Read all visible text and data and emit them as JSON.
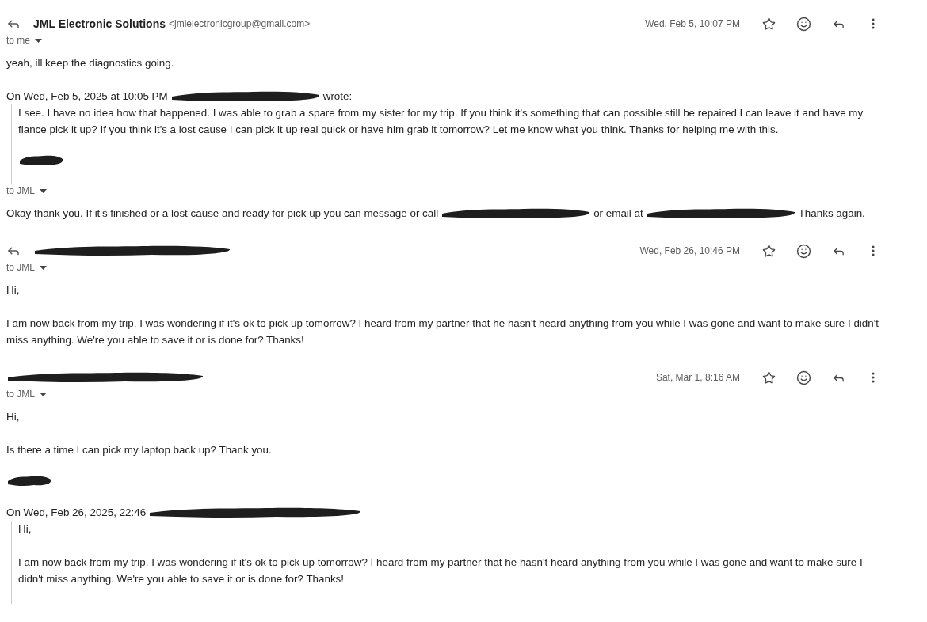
{
  "messages": [
    {
      "header": {
        "reply_icon": true,
        "sender": [
          {
            "kind": "name",
            "text": "JML Electronic Solutions"
          },
          {
            "kind": "email",
            "text": "<jmlelectronicgroup@gmail.com>"
          }
        ],
        "date": "Wed, Feb 5, 10:07 PM"
      },
      "recipients": "to me",
      "blocks": [
        {
          "kind": "paragraph",
          "segments": [
            {
              "kind": "text",
              "text": "yeah, ill keep the diagnostics going."
            }
          ]
        },
        {
          "kind": "attribution",
          "segments": [
            {
              "kind": "text",
              "text": "On Wed, Feb 5, 2025 at 10:05 PM"
            },
            {
              "kind": "redaction"
            },
            {
              "kind": "text",
              "text": "wrote:"
            }
          ]
        },
        {
          "kind": "quote",
          "children": [
            {
              "kind": "paragraph",
              "segments": [
                {
                  "kind": "text",
                  "text": "I see. I have no idea how that happened. I was able to grab a spare from my sister for my trip. If you think it's something that can possible still be repaired I can leave it and have my fiance pick it up? If you think it's a lost cause I can pick it up real quick or have him grab it tomorrow? Let me know what you think. Thanks for helping me with this."
                }
              ]
            },
            {
              "kind": "signature"
            }
          ]
        }
      ]
    },
    {
      "recipients": "to JML",
      "blocks": [
        {
          "kind": "paragraph",
          "segments": [
            {
              "kind": "text",
              "text": "Okay thank you. If it's finished or a lost cause and ready for pick up you can message or call"
            },
            {
              "kind": "redaction"
            },
            {
              "kind": "text",
              "text": "or email at"
            },
            {
              "kind": "redaction"
            },
            {
              "kind": "text",
              "text": "Thanks again."
            }
          ]
        }
      ]
    },
    {
      "header": {
        "reply_icon": true,
        "sender": [
          {
            "kind": "redaction"
          }
        ],
        "date": "Wed, Feb 26, 10:46 PM"
      },
      "recipients": "to JML",
      "blocks": [
        {
          "kind": "paragraph",
          "segments": [
            {
              "kind": "text",
              "text": "Hi,"
            }
          ]
        },
        {
          "kind": "paragraph",
          "segments": [
            {
              "kind": "text",
              "text": "I am now back from my trip. I was wondering if it's ok to pick up tomorrow? I heard from my partner that he hasn't heard anything from you while I was gone and want to make sure I didn't miss anything. We're you able to save it or is done for? Thanks!"
            }
          ]
        }
      ]
    },
    {
      "header": {
        "reply_icon": false,
        "sender": [
          {
            "kind": "redaction"
          }
        ],
        "date": "Sat, Mar 1, 8:16 AM"
      },
      "recipients": "to JML",
      "blocks": [
        {
          "kind": "paragraph",
          "segments": [
            {
              "kind": "text",
              "text": "Hi,"
            }
          ]
        },
        {
          "kind": "paragraph",
          "segments": [
            {
              "kind": "text",
              "text": "Is there a time I can pick my laptop back up? Thank you."
            }
          ]
        },
        {
          "kind": "signature"
        },
        {
          "kind": "attribution",
          "segments": [
            {
              "kind": "text",
              "text": "On Wed, Feb 26, 2025, 22:46"
            },
            {
              "kind": "redaction"
            }
          ]
        },
        {
          "kind": "quote",
          "children": [
            {
              "kind": "paragraph",
              "segments": [
                {
                  "kind": "text",
                  "text": "Hi,"
                }
              ]
            },
            {
              "kind": "paragraph",
              "segments": [
                {
                  "kind": "text",
                  "text": "I am now back from my trip. I was wondering if it's ok to pick up tomorrow? I heard from my partner that he hasn't heard anything from you while I was gone and want to make sure I didn't miss anything. We're you able to save it or is done for? Thanks!"
                }
              ]
            }
          ]
        }
      ]
    }
  ]
}
